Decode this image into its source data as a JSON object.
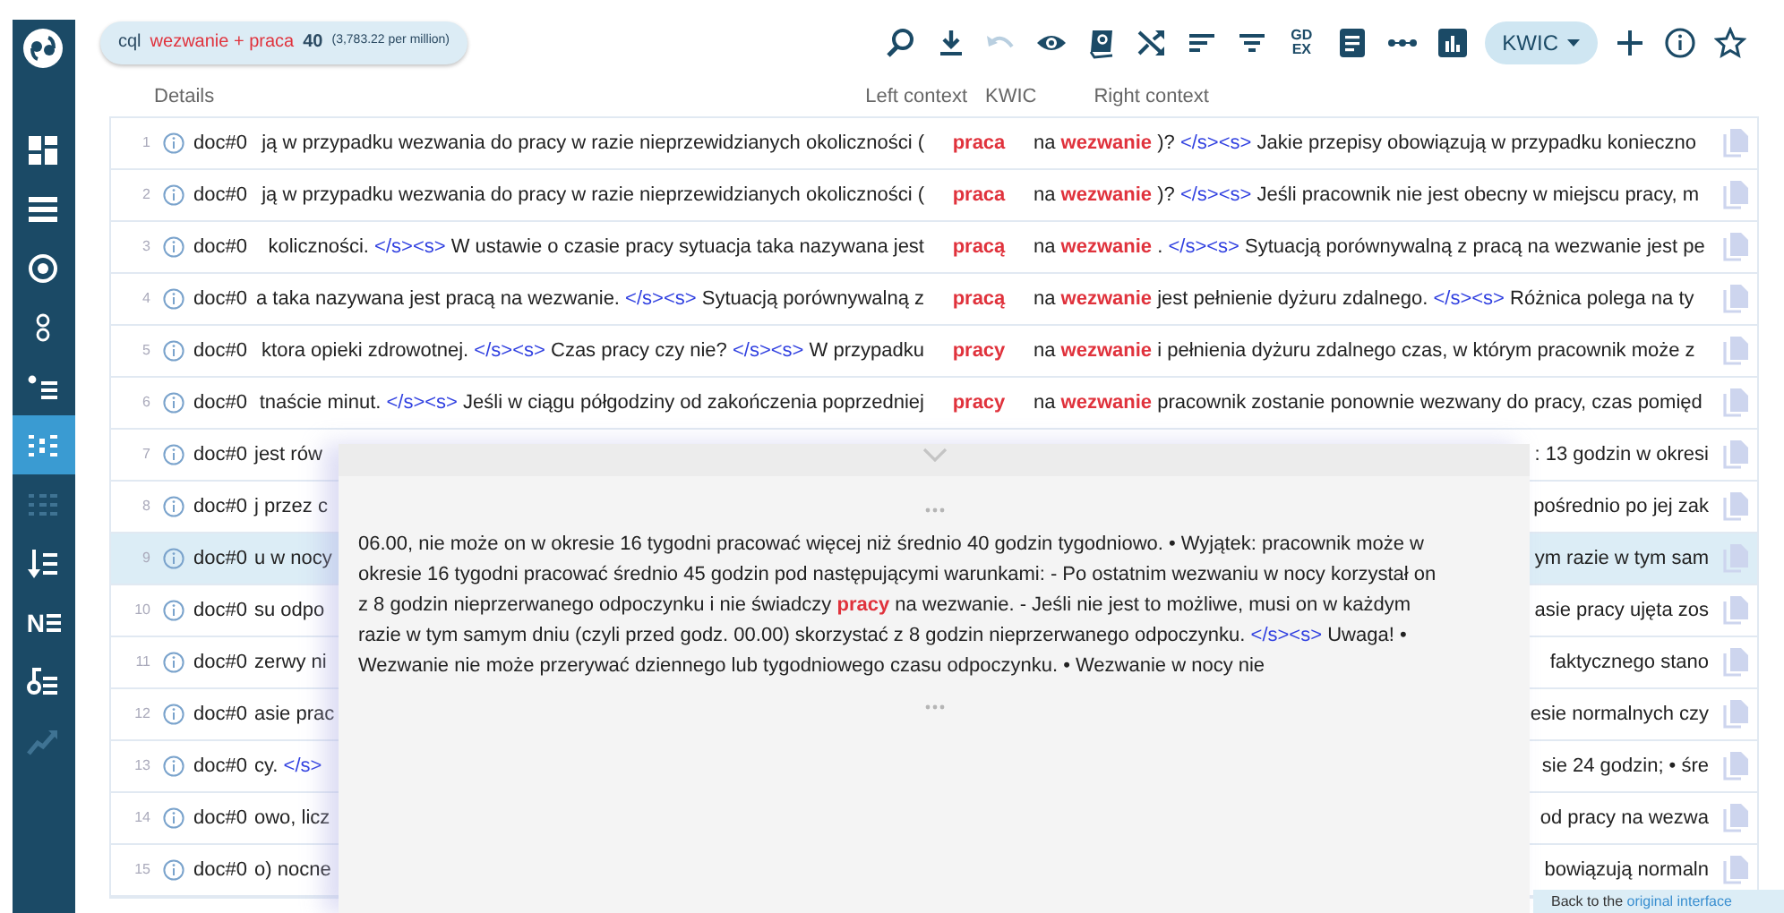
{
  "sidebar": {
    "items": [
      {
        "kind": "dashboard",
        "selected": false,
        "disabled": false
      },
      {
        "kind": "list",
        "selected": false,
        "disabled": false
      },
      {
        "kind": "target",
        "selected": false,
        "disabled": false
      },
      {
        "kind": "rings",
        "selected": false,
        "disabled": false
      },
      {
        "kind": "bullets",
        "selected": false,
        "disabled": false
      },
      {
        "kind": "kwic",
        "selected": true,
        "disabled": false
      },
      {
        "kind": "grid",
        "selected": false,
        "disabled": true
      },
      {
        "kind": "sort",
        "selected": false,
        "disabled": false
      },
      {
        "kind": "ne",
        "label": "N",
        "selected": false,
        "disabled": false
      },
      {
        "kind": "note",
        "selected": false,
        "disabled": false
      },
      {
        "kind": "trend",
        "selected": false,
        "disabled": true
      }
    ]
  },
  "query": {
    "label": "cql",
    "expression": "wezwanie + praca",
    "count": "40",
    "frequency": "(3,783.22 per million)"
  },
  "toolbar": {
    "items": [
      {
        "kind": "zoom-out",
        "disabled": false
      },
      {
        "kind": "download",
        "disabled": false
      },
      {
        "kind": "undo",
        "disabled": true
      },
      {
        "kind": "eye",
        "disabled": false
      },
      {
        "kind": "book",
        "disabled": false
      },
      {
        "kind": "shuffle",
        "disabled": false
      },
      {
        "kind": "sort",
        "disabled": false
      },
      {
        "kind": "filter",
        "disabled": false
      },
      {
        "kind": "gdex",
        "lines": [
          "GD",
          "EX"
        ],
        "disabled": false
      },
      {
        "kind": "document",
        "disabled": false
      },
      {
        "kind": "dots",
        "disabled": false
      },
      {
        "kind": "chart",
        "disabled": false
      },
      {
        "kind": "view",
        "label": "KWIC",
        "disabled": false
      },
      {
        "kind": "plus",
        "disabled": false
      },
      {
        "kind": "info",
        "disabled": false
      },
      {
        "kind": "star",
        "disabled": false
      }
    ]
  },
  "table": {
    "columns": [
      "Details",
      "Left context",
      "KWIC",
      "Right context"
    ],
    "rows": [
      {
        "number": "1",
        "doc": "doc#0",
        "selected": false,
        "left": [
          {
            "kind": "text",
            "text": "ją w przypadku wezwania do pracy w razie nieprzewidzianych okoliczności ("
          }
        ],
        "kwic": "praca",
        "right": [
          {
            "kind": "text",
            "text": "na "
          },
          {
            "kind": "match",
            "text": "wezwanie"
          },
          {
            "kind": "text",
            "text": " )? "
          },
          {
            "kind": "tag",
            "text": "</s><s>"
          },
          {
            "kind": "text",
            "text": " Jakie przepisy obowiązują w przypadku konieczno"
          }
        ]
      },
      {
        "number": "2",
        "doc": "doc#0",
        "selected": false,
        "left": [
          {
            "kind": "text",
            "text": "ją w przypadku wezwania do pracy w razie nieprzewidzianych okoliczności ("
          }
        ],
        "kwic": "praca",
        "right": [
          {
            "kind": "text",
            "text": "na "
          },
          {
            "kind": "match",
            "text": "wezwanie"
          },
          {
            "kind": "text",
            "text": " )? "
          },
          {
            "kind": "tag",
            "text": "</s><s>"
          },
          {
            "kind": "text",
            "text": " Jeśli pracownik nie jest obecny w miejscu pracy, m"
          }
        ]
      },
      {
        "number": "3",
        "doc": "doc#0",
        "selected": false,
        "left": [
          {
            "kind": "text",
            "text": "koliczności. "
          },
          {
            "kind": "tag",
            "text": "</s><s>"
          },
          {
            "kind": "text",
            "text": " W ustawie o czasie pracy sytuacja taka nazywana jest"
          }
        ],
        "kwic": "pracą",
        "right": [
          {
            "kind": "text",
            "text": "na "
          },
          {
            "kind": "match",
            "text": "wezwanie"
          },
          {
            "kind": "text",
            "text": " . "
          },
          {
            "kind": "tag",
            "text": "</s><s>"
          },
          {
            "kind": "text",
            "text": " Sytuacją porównywalną z pracą na wezwanie jest pe"
          }
        ]
      },
      {
        "number": "4",
        "doc": "doc#0",
        "selected": false,
        "left": [
          {
            "kind": "text",
            "text": "a taka nazywana jest pracą na wezwanie. "
          },
          {
            "kind": "tag",
            "text": "</s><s>"
          },
          {
            "kind": "text",
            "text": " Sytuacją porównywalną z"
          }
        ],
        "kwic": "pracą",
        "right": [
          {
            "kind": "text",
            "text": "na "
          },
          {
            "kind": "match",
            "text": "wezwanie"
          },
          {
            "kind": "text",
            "text": " jest pełnienie dyżuru zdalnego. "
          },
          {
            "kind": "tag",
            "text": "</s><s>"
          },
          {
            "kind": "text",
            "text": " Różnica polega na ty"
          }
        ]
      },
      {
        "number": "5",
        "doc": "doc#0",
        "selected": false,
        "left": [
          {
            "kind": "text",
            "text": "ktora opieki zdrowotnej. "
          },
          {
            "kind": "tag",
            "text": "</s><s>"
          },
          {
            "kind": "text",
            "text": " Czas pracy czy nie? "
          },
          {
            "kind": "tag",
            "text": "</s><s>"
          },
          {
            "kind": "text",
            "text": " W przypadku"
          }
        ],
        "kwic": "pracy",
        "right": [
          {
            "kind": "text",
            "text": "na "
          },
          {
            "kind": "match",
            "text": "wezwanie"
          },
          {
            "kind": "text",
            "text": " i pełnienia dyżuru zdalnego czas, w którym pracownik może z"
          }
        ]
      },
      {
        "number": "6",
        "doc": "doc#0",
        "selected": false,
        "left": [
          {
            "kind": "text",
            "text": "tnaście minut. "
          },
          {
            "kind": "tag",
            "text": "</s><s>"
          },
          {
            "kind": "text",
            "text": " Jeśli w ciągu półgodziny od zakończenia poprzedniej"
          }
        ],
        "kwic": "pracy",
        "right": [
          {
            "kind": "text",
            "text": "na "
          },
          {
            "kind": "match",
            "text": "wezwanie"
          },
          {
            "kind": "text",
            "text": " pracownik zostanie ponownie wezwany do pracy, czas pomięd"
          }
        ]
      },
      {
        "number": "7",
        "doc": "doc#0",
        "selected": false,
        "left": [
          {
            "kind": "text",
            "text": "jest rów"
          }
        ],
        "right": [
          {
            "kind": "text",
            "text": ": 13 godzin w okresi"
          }
        ]
      },
      {
        "number": "8",
        "doc": "doc#0",
        "selected": false,
        "left": [
          {
            "kind": "text",
            "text": "j przez c"
          }
        ],
        "right": [
          {
            "kind": "text",
            "text": "pośrednio po jej zak"
          }
        ]
      },
      {
        "number": "9",
        "doc": "doc#0",
        "selected": true,
        "left": [
          {
            "kind": "text",
            "text": "u w nocy"
          }
        ],
        "right": [
          {
            "kind": "text",
            "text": "ym razie w tym sam"
          }
        ]
      },
      {
        "number": "10",
        "doc": "doc#0",
        "selected": false,
        "left": [
          {
            "kind": "text",
            "text": "su odpo"
          }
        ],
        "right": [
          {
            "kind": "text",
            "text": "asie pracy ujęta zos"
          }
        ]
      },
      {
        "number": "11",
        "doc": "doc#0",
        "selected": false,
        "left": [
          {
            "kind": "text",
            "text": "zerwy ni"
          }
        ],
        "right": [
          {
            "kind": "text",
            "text": "faktycznego stano"
          }
        ]
      },
      {
        "number": "12",
        "doc": "doc#0",
        "selected": false,
        "left": [
          {
            "kind": "text",
            "text": "asie prac"
          }
        ],
        "right": [
          {
            "kind": "text",
            "text": "esie normalnych czy"
          }
        ]
      },
      {
        "number": "13",
        "doc": "doc#0",
        "selected": false,
        "left": [
          {
            "kind": "text",
            "text": "cy. "
          },
          {
            "kind": "tag",
            "text": "</s>"
          }
        ],
        "right": [
          {
            "kind": "text",
            "text": "sie 24 godzin; • śre"
          }
        ]
      },
      {
        "number": "14",
        "doc": "doc#0",
        "selected": false,
        "left": [
          {
            "kind": "text",
            "text": "owo, licz"
          }
        ],
        "right": [
          {
            "kind": "text",
            "text": "od pracy na wezwa"
          }
        ]
      },
      {
        "number": "15",
        "doc": "doc#0",
        "selected": false,
        "left": [
          {
            "kind": "text",
            "text": "o) nocne"
          }
        ],
        "right": [
          {
            "kind": "text",
            "text": "bowiązują normaln"
          }
        ]
      }
    ]
  },
  "detail": {
    "segments": [
      {
        "kind": "text",
        "text": "06.00, nie może on w okresie 16 tygodni pracować więcej niż średnio 40 godzin tygodniowo. • Wyjątek: pracownik może w okresie 16 tygodni pracować średnio 45 godzin pod następującymi warunkami: - Po ostatnim wezwaniu w nocy korzystał on z 8 godzin nieprzerwanego odpoczynku i nie świadczy "
      },
      {
        "kind": "match",
        "text": "pracy"
      },
      {
        "kind": "text",
        "text": " na wezwanie. - Jeśli nie jest to możliwe, musi on w każdym razie w tym samym dniu (czyli przed godz. 00.00) skorzystać z 8 godzin nieprzerwanego odpoczynku. "
      },
      {
        "kind": "tag",
        "text": "</s><s>"
      },
      {
        "kind": "text",
        "text": " Uwaga! • Wezwanie nie może przerywać dziennego lub tygodniowego czasu odpoczynku. • Wezwanie w nocy nie"
      }
    ]
  },
  "footer": {
    "text": "Back to the",
    "link": "original interface"
  }
}
